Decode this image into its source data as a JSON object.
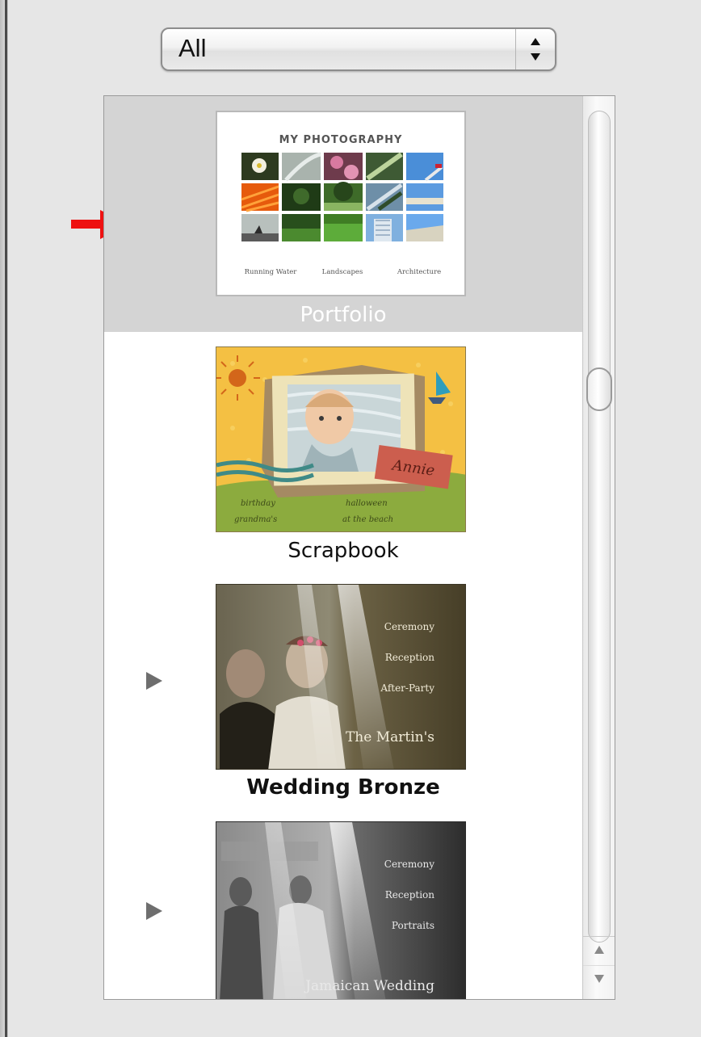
{
  "popup": {
    "selected": "All"
  },
  "themes": [
    {
      "label": "Portfolio",
      "selected": true,
      "thumb": {
        "title": "MY PHOTOGRAPHY",
        "categories": [
          "Running Water",
          "Landscapes",
          "Architecture"
        ]
      }
    },
    {
      "label": "Scrapbook",
      "selected": false,
      "thumb": {
        "tag": "Annie",
        "captions": [
          "birthday",
          "halloween",
          "grandma's",
          "at the beach"
        ]
      }
    },
    {
      "label": "Wedding Bronze",
      "selected": false,
      "thumb": {
        "menu": [
          "Ceremony",
          "Reception",
          "After-Party"
        ],
        "title": "The Martin's"
      }
    },
    {
      "label": "",
      "selected": false,
      "thumb": {
        "menu": [
          "Ceremony",
          "Reception",
          "Portraits"
        ],
        "title": "Jamaican Wedding"
      }
    }
  ],
  "colors": {
    "selection": "#d4d4d4",
    "arrow": "#ee1111"
  }
}
